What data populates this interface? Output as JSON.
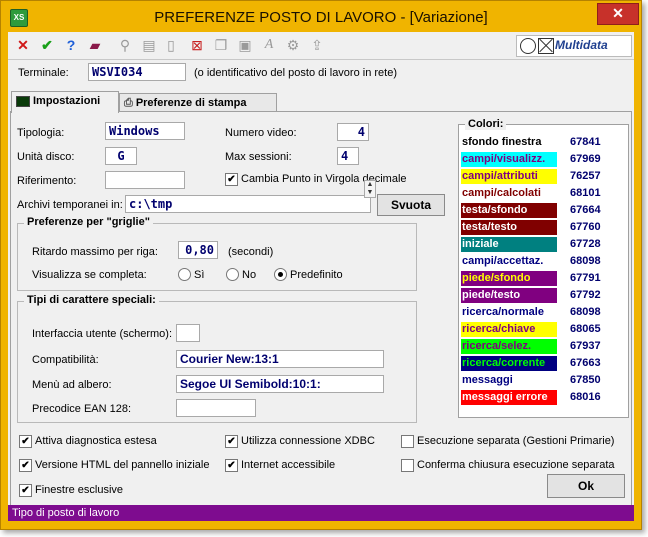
{
  "window": {
    "title": "PREFERENZE POSTO DI LAVORO - [Variazione]",
    "app_icon_text": "XS",
    "close_glyph": "✕"
  },
  "toolbar": {
    "logo_text": "Multidata",
    "icons": [
      "cancel-icon",
      "confirm-icon",
      "help-icon",
      "book-icon",
      "binoculars-icon",
      "print-icon",
      "document-icon",
      "delete-icon",
      "copy-icon",
      "paste-icon",
      "font-icon",
      "settings-icon",
      "export-icon"
    ]
  },
  "terminal": {
    "label": "Terminale:",
    "value": "WSVI034",
    "hint": "(o identificativo del posto di lavoro in rete)"
  },
  "tabs": [
    {
      "label": "Impostazioni",
      "active": true
    },
    {
      "label": "Preferenze di stampa",
      "active": false
    }
  ],
  "settings": {
    "tipologia_label": "Tipologia:",
    "tipologia_value": "Windows",
    "unita_label": "Unità disco:",
    "unita_value": "G",
    "riferimento_label": "Riferimento:",
    "riferimento_value": "",
    "numero_video_label": "Numero video:",
    "numero_video_value": "4",
    "max_sessioni_label": "Max sessioni:",
    "max_sessioni_value": "4",
    "cambia_label": "Cambia Punto in Virgola decimale",
    "cambia_checked": true,
    "archivi_label": "Archivi temporanei in:",
    "archivi_value": "c:\\tmp",
    "svuota_label": "Svuota"
  },
  "griglie": {
    "title": "Preferenze per \"griglie\"",
    "ritardo_label": "Ritardo massimo per riga:",
    "ritardo_value": "0,80",
    "ritardo_unit": "(secondi)",
    "visualizza_label": "Visualizza se completa:",
    "options": [
      {
        "label": "Sì",
        "selected": false
      },
      {
        "label": "No",
        "selected": false
      },
      {
        "label": "Predefinito",
        "selected": true
      }
    ]
  },
  "fonts": {
    "title": "Tipi di carattere speciali:",
    "interfaccia_label": "Interfaccia utente (schermo):",
    "interfaccia_value": "",
    "compat_label": "Compatibilità:",
    "compat_value": "Courier New:13:1",
    "menu_label": "Menù ad albero:",
    "menu_value": "Segoe UI Semibold:10:1:",
    "ean_label": "Precodice EAN 128:",
    "ean_value": ""
  },
  "colors": {
    "title": "Colori:",
    "items": [
      {
        "name": "sfondo finestra",
        "value": "67841",
        "bg": "#ffffff",
        "fg": "#000000"
      },
      {
        "name": "campi/visualizz.",
        "value": "67969",
        "bg": "#00ffff",
        "fg": "#800080"
      },
      {
        "name": "campi/attributi",
        "value": "76257",
        "bg": "#ffff00",
        "fg": "#800080"
      },
      {
        "name": "campi/calcolati",
        "value": "68101",
        "bg": "#ffffff",
        "fg": "#800000"
      },
      {
        "name": "testa/sfondo",
        "value": "67664",
        "bg": "#800000",
        "fg": "#ffffff"
      },
      {
        "name": "testa/testo",
        "value": "67760",
        "bg": "#800000",
        "fg": "#ffffff"
      },
      {
        "name": "iniziale",
        "value": "67728",
        "bg": "#008080",
        "fg": "#ffffff"
      },
      {
        "name": "campi/accettaz.",
        "value": "68098",
        "bg": "#ffffff",
        "fg": "#000080"
      },
      {
        "name": "piede/sfondo",
        "value": "67791",
        "bg": "#800080",
        "fg": "#ffff00"
      },
      {
        "name": "piede/testo",
        "value": "67792",
        "bg": "#800080",
        "fg": "#ffffff"
      },
      {
        "name": "ricerca/normale",
        "value": "68098",
        "bg": "#ffffff",
        "fg": "#000080"
      },
      {
        "name": "ricerca/chiave",
        "value": "68065",
        "bg": "#ffff00",
        "fg": "#800080"
      },
      {
        "name": "ricerca/selez.",
        "value": "67937",
        "bg": "#00ff00",
        "fg": "#800080"
      },
      {
        "name": "ricerca/corrente",
        "value": "67663",
        "bg": "#000080",
        "fg": "#00ff00"
      },
      {
        "name": "messaggi",
        "value": "67850",
        "bg": "#ffffff",
        "fg": "#000080"
      },
      {
        "name": "messaggi errore",
        "value": "68016",
        "bg": "#ff0000",
        "fg": "#ffffff"
      }
    ]
  },
  "checkboxes": [
    {
      "label": "Attiva diagnostica estesa",
      "checked": true
    },
    {
      "label": "Utilizza connessione XDBC",
      "checked": true
    },
    {
      "label": "Esecuzione separata (Gestioni Primarie)",
      "checked": false
    },
    {
      "label": "Versione HTML del pannello iniziale",
      "checked": true
    },
    {
      "label": "Internet accessibile",
      "checked": true
    },
    {
      "label": "Conferma chiusura esecuzione separata",
      "checked": false
    },
    {
      "label": "Finestre esclusive",
      "checked": true
    }
  ],
  "ok_label": "Ok",
  "status_text": "Tipo di posto di lavoro"
}
